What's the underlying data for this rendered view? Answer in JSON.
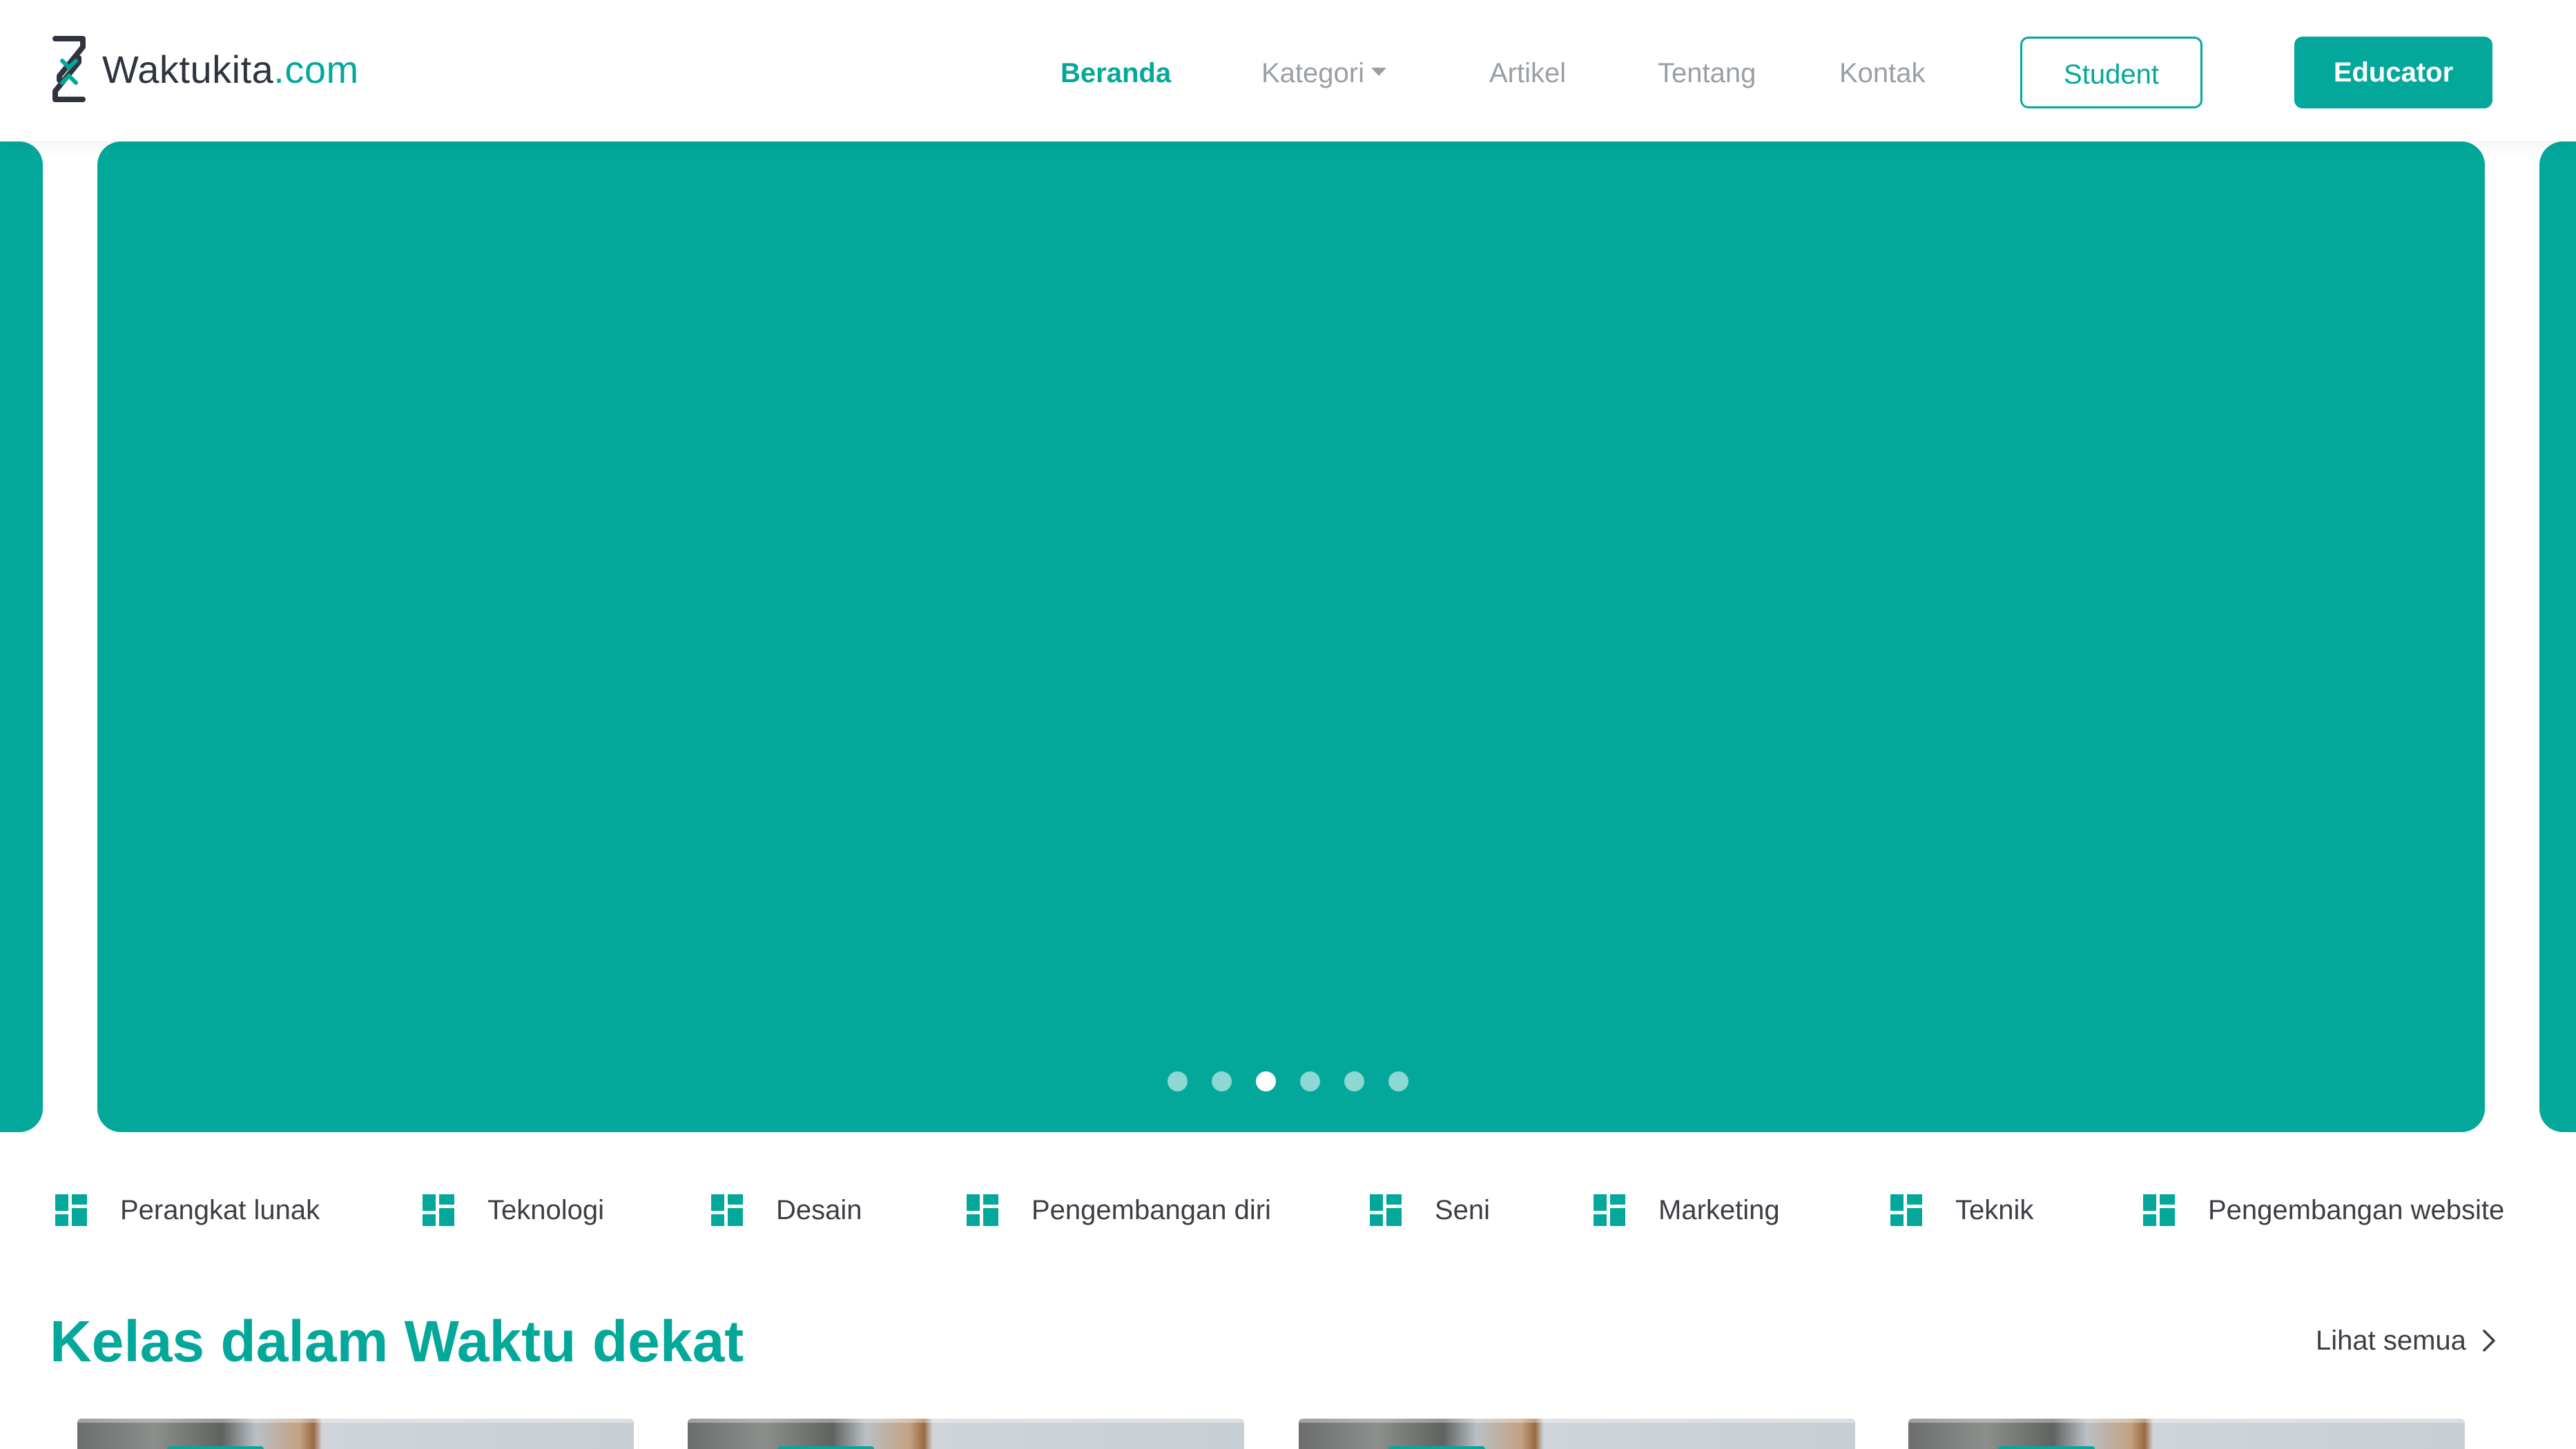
{
  "brand": {
    "name": "Waktukita",
    "tld": ".com",
    "accent_color": "#04a89b",
    "text_color": "#2f3440"
  },
  "nav": {
    "links": [
      "Beranda",
      "Kategori",
      "Artikel",
      "Tentang",
      "Kontak"
    ],
    "active": "Beranda",
    "student_label": "Student",
    "educator_label": "Educator"
  },
  "carousel": {
    "slide_count": 6,
    "active_slide": 3,
    "background_color": "#04a89b"
  },
  "categories": [
    "Perangkat lunak",
    "Teknologi",
    "Desain",
    "Pengembangan diri",
    "Seni",
    "Marketing",
    "Teknik",
    "Pengembangan website"
  ],
  "category_icon": "grid-icon",
  "section": {
    "title": "Kelas dalam Waktu dekat",
    "see_all": "Lihat semua",
    "see_all_icon": "chevron-right-icon",
    "card_count": 4
  }
}
